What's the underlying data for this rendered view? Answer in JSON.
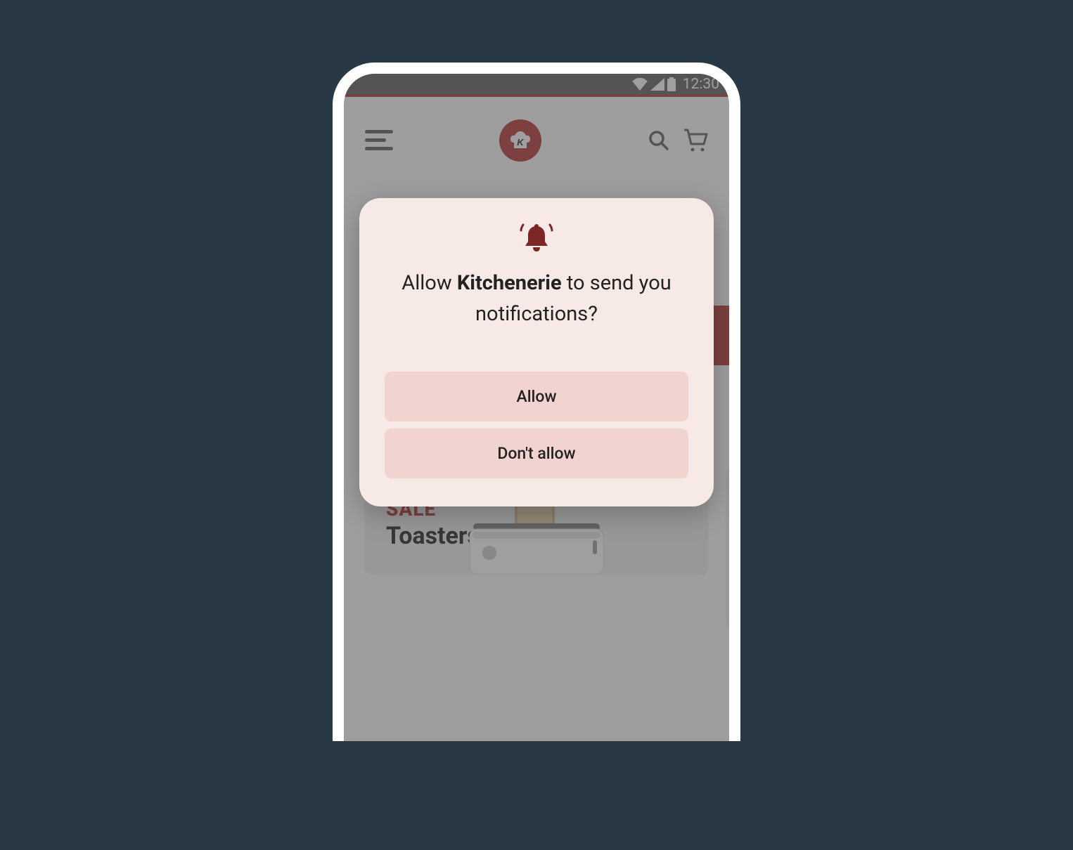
{
  "statusBar": {
    "time": "12:30"
  },
  "header": {
    "logo_letter": "K"
  },
  "card": {
    "badge": "SALE",
    "title": "Toasters"
  },
  "dialog": {
    "prompt_prefix": "Allow ",
    "prompt_app": "Kitchenerie",
    "prompt_suffix": " to send you notifications?",
    "allow_label": "Allow",
    "deny_label": "Don't allow"
  }
}
